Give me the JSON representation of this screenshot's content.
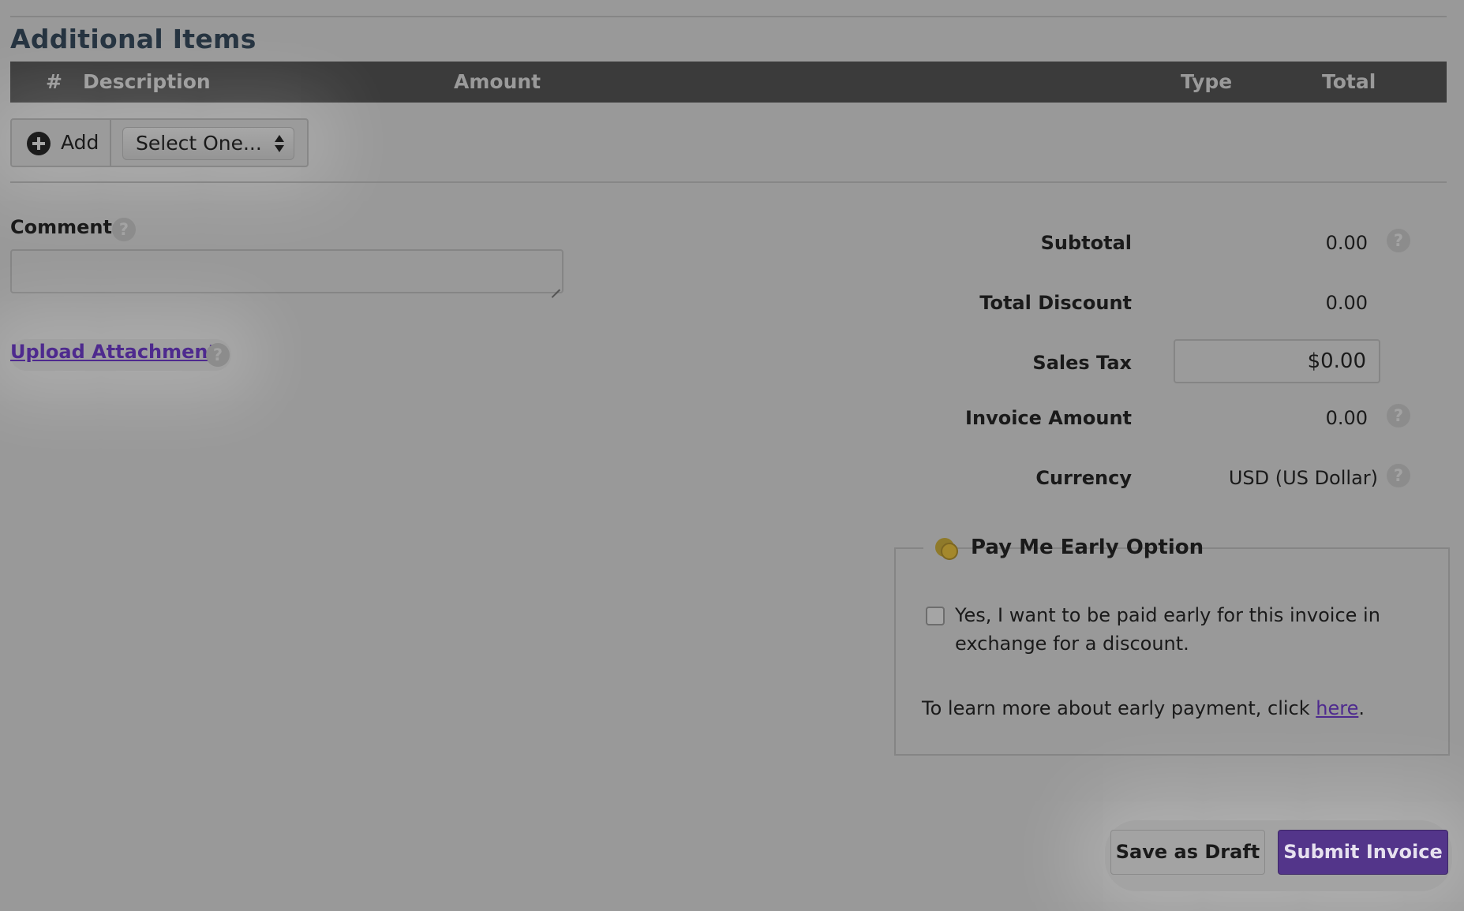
{
  "section": {
    "title": "Additional Items"
  },
  "items_table": {
    "columns": [
      "#",
      "Description",
      "Amount",
      "Type",
      "Total"
    ]
  },
  "add_controls": {
    "add_label": "Add",
    "select_value": "Select One..."
  },
  "comment": {
    "label": "Comment",
    "help": "?",
    "value": ""
  },
  "upload": {
    "link_text": "Upload Attachment",
    "help": "?"
  },
  "summary": {
    "subtotal_label": "Subtotal",
    "subtotal_value": "0.00",
    "total_discount_label": "Total Discount",
    "total_discount_value": "0.00",
    "sales_tax_label": "Sales Tax",
    "sales_tax_value": "$0.00",
    "invoice_amount_label": "Invoice Amount",
    "invoice_amount_value": "0.00",
    "currency_label": "Currency",
    "currency_value": "USD (US Dollar)",
    "help": "?"
  },
  "early_payment": {
    "legend": "Pay Me Early Option",
    "checkbox_checked": false,
    "checkbox_text": "Yes, I want to be paid early for this invoice in exchange for a discount.",
    "learn_more_prefix": "To learn more about early payment, click ",
    "learn_more_link": "here",
    "learn_more_suffix": "."
  },
  "actions": {
    "save_draft_label": "Save as Draft",
    "submit_label": "Submit Invoice"
  },
  "colors": {
    "accent": "#53358a",
    "link": "#4e2a8e",
    "header_bg": "#3b3b3b",
    "overlay_bg": "#999999"
  }
}
